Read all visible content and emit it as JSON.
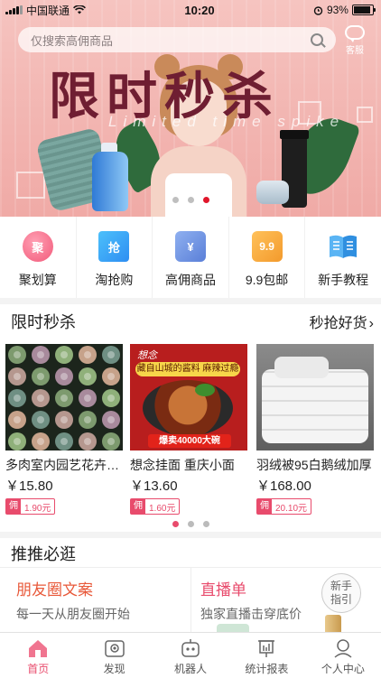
{
  "status_bar": {
    "carrier": "中国联通",
    "time": "10:20",
    "battery_percent": "93%",
    "battery_level": 0.93
  },
  "header": {
    "search_placeholder": "仅搜索高佣商品",
    "service_label": "客服"
  },
  "banner": {
    "title": "限时秒杀",
    "subtitle": "Limited time spike",
    "slide_count": 3,
    "active_slide": 3
  },
  "quick_nav": [
    {
      "label": "聚划算",
      "icon": "ju-icon",
      "icon_text": "聚",
      "color": "#f25a7a"
    },
    {
      "label": "淘抢购",
      "icon": "qiang-icon",
      "icon_text": "抢",
      "color": "#2ea8f2"
    },
    {
      "label": "高佣商品",
      "icon": "ticket-icon",
      "icon_text": "¥",
      "color": "#6d8fdf"
    },
    {
      "label": "9.9包邮",
      "icon": "price-tag-icon",
      "icon_text": "9.9",
      "color": "#f39a2c"
    },
    {
      "label": "新手教程",
      "icon": "book-icon",
      "icon_text": "",
      "color": "#3b9ee8"
    }
  ],
  "flash_sale": {
    "title": "限时秒杀",
    "more_label": "秒抢好货",
    "products": [
      {
        "name": "多肉室内园艺花卉绿植",
        "price": "￥15.80",
        "commission_tag": "佣",
        "commission": "1.90元"
      },
      {
        "name": "想念挂面 重庆小面",
        "price": "￥13.60",
        "commission_tag": "佣",
        "commission": "1.60元"
      },
      {
        "name": "羽绒被95白鹅绒加厚",
        "price": "￥168.00",
        "commission_tag": "佣",
        "commission": "20.10元"
      }
    ],
    "page_count": 3,
    "active_page": 1,
    "noodle_badge": "爆卖40000大碗",
    "noodle_brand": "想念",
    "noodle_tagline": "藏自山城的酱料 麻辣过瘾"
  },
  "recommend": {
    "title": "推推必逛",
    "cards": [
      {
        "title": "朋友圈文案",
        "subtitle": "每一天从朋友圈开始",
        "color": "#e8593a"
      },
      {
        "title": "直播单",
        "subtitle": "独家直播击穿底价",
        "color": "#e84b6c",
        "badge": "新手指引"
      }
    ]
  },
  "tab_bar": [
    {
      "label": "首页",
      "icon": "home-icon",
      "active": true
    },
    {
      "label": "发现",
      "icon": "discover-icon",
      "active": false
    },
    {
      "label": "机器人",
      "icon": "robot-icon",
      "active": false
    },
    {
      "label": "统计报表",
      "icon": "report-icon",
      "active": false
    },
    {
      "label": "个人中心",
      "icon": "user-icon",
      "active": false
    }
  ]
}
